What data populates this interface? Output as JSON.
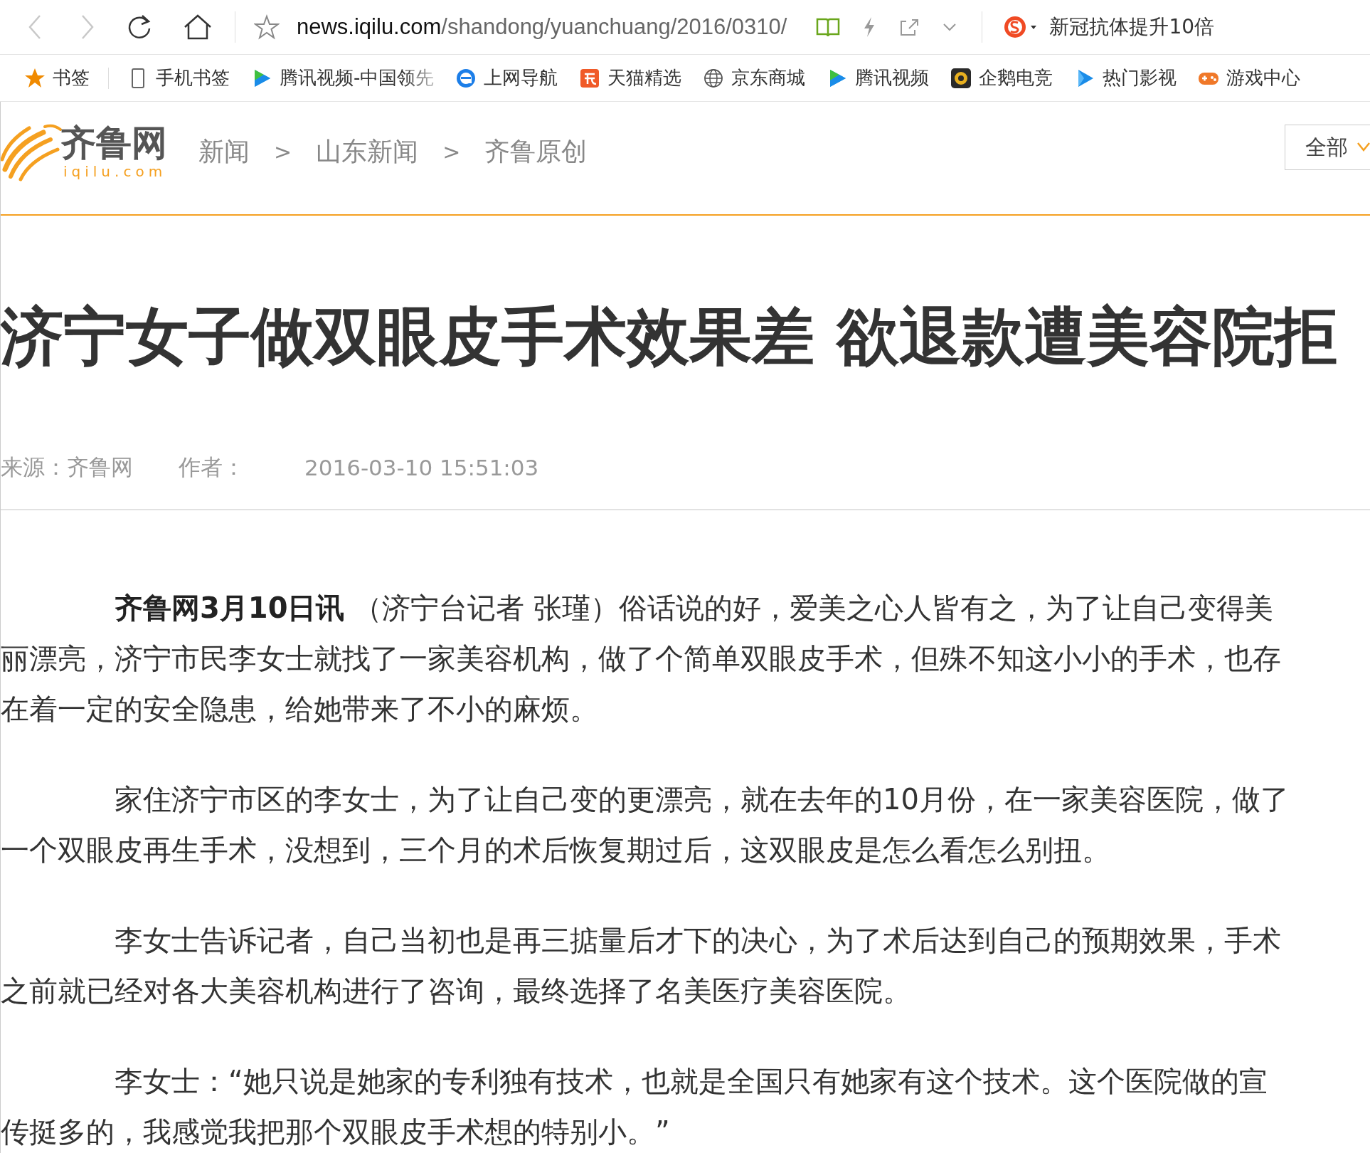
{
  "toolbar": {
    "address": {
      "host": "news.iqilu.com",
      "path": "/shandong/yuanchuang/2016/0310/"
    },
    "search_suggestion": "新冠抗体提升10倍"
  },
  "bookmarks": [
    {
      "label": "书签",
      "kind": "star"
    },
    {
      "label": "手机书签",
      "kind": "phone"
    },
    {
      "label": "腾讯视频-中国领先",
      "kind": "video"
    },
    {
      "label": "上网导航",
      "kind": "browser"
    },
    {
      "label": "天猫精选",
      "kind": "shop"
    },
    {
      "label": "京东商城",
      "kind": "globe"
    },
    {
      "label": "腾讯视频",
      "kind": "video"
    },
    {
      "label": "企鹅电竞",
      "kind": "badge"
    },
    {
      "label": "热门影视",
      "kind": "play"
    },
    {
      "label": "游戏中心",
      "kind": "game"
    }
  ],
  "header": {
    "logo": {
      "name": "齐鲁网",
      "domain": "iqilu.com"
    },
    "breadcrumb": [
      {
        "label": "新闻"
      },
      {
        "separator": ">",
        "label": "山东新闻"
      },
      {
        "separator": ">",
        "label": "齐鲁原创"
      }
    ],
    "search_scope": "全部"
  },
  "article": {
    "title": "济宁女子做双眼皮手术效果差 欲退款遭美容院拒",
    "meta": {
      "source": "来源：齐鲁网",
      "author_label": "作者：",
      "date": "2016-03-10 15:51:03"
    },
    "paragraphs": [
      "**齐鲁网3月10日讯** （济宁台记者 张瑾）俗话说的好，爱美之心人皆有之，为了让自己变得美丽漂亮，济宁市民李女士就找了一家美容机构，做了个简单双眼皮手术，但殊不知这小小的手术，也存在着一定的安全隐患，给她带来了不小的麻烦。",
      "家住济宁市区的李女士，为了让自己变的更漂亮，就在去年的10月份，在一家美容医院，做了一个双眼皮再生手术，没想到，三个月的术后恢复期过后，这双眼皮是怎么看怎么别扭。",
      "李女士告诉记者，自己当初也是再三掂量后才下的决心，为了术后达到自己的预期效果，手术之前就已经对各大美容机构进行了咨询，最终选择了名美医疗美容医院。",
      "李女士：“她只说是她家的专利独有技术，也就是全国只有她家有这个技术。这个医院做的宣传挺多的，我感觉我把那个双眼皮手术想的特别小。”"
    ]
  }
}
